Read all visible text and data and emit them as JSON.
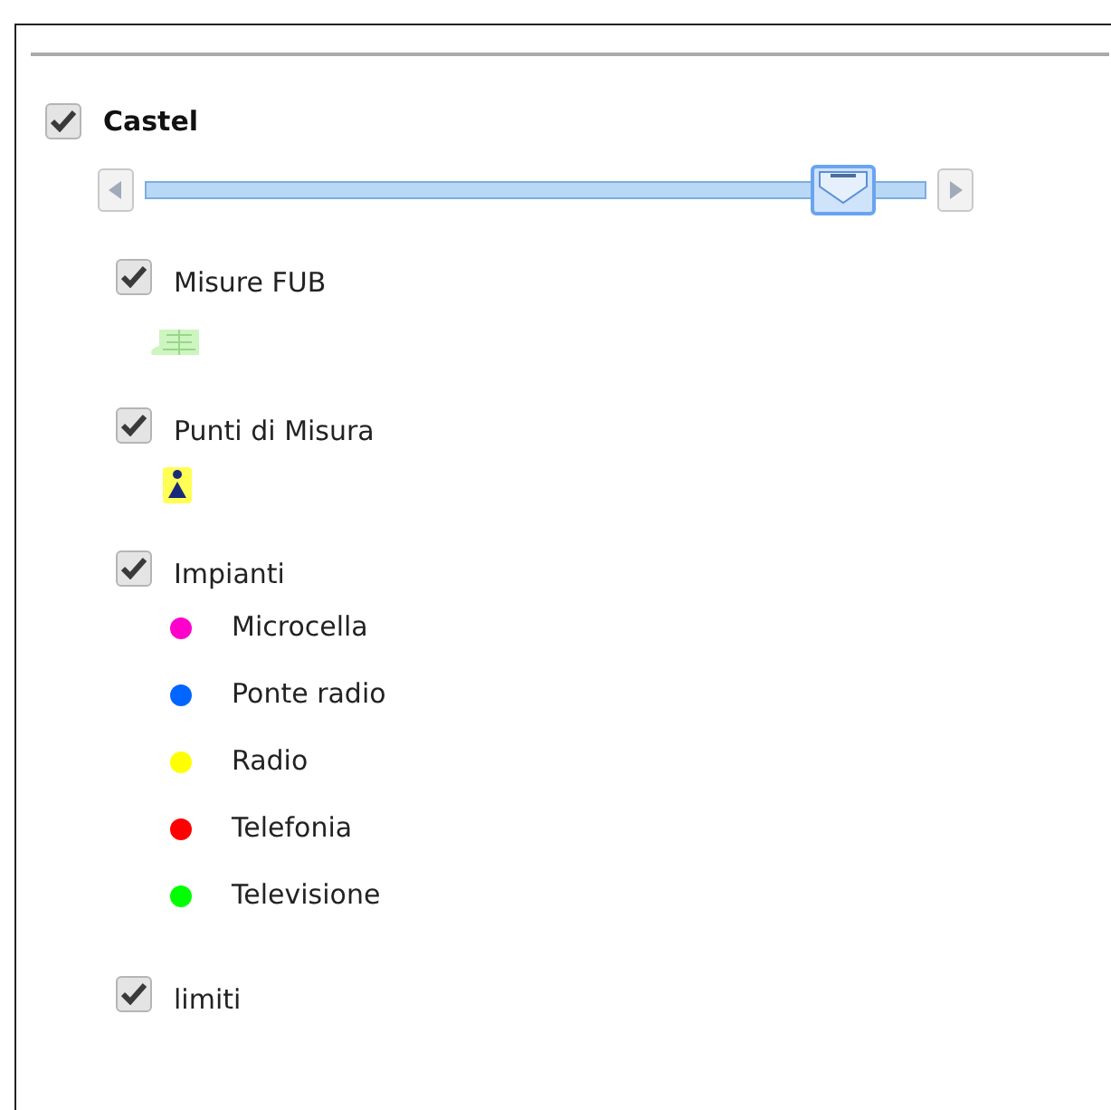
{
  "group": {
    "label": "Castel",
    "checked": true,
    "opacity": {
      "level": 0.93
    }
  },
  "layers": [
    {
      "label": "Misure FUB",
      "checked": true,
      "kind": "fub"
    },
    {
      "label": "Punti di Misura",
      "checked": true,
      "kind": "point"
    },
    {
      "label": "Impianti",
      "checked": true,
      "kind": "legend",
      "legend": [
        {
          "label": "Microcella",
          "color": "#ff00cc"
        },
        {
          "label": "Ponte radio",
          "color": "#0066ff"
        },
        {
          "label": "Radio",
          "color": "#ffff00"
        },
        {
          "label": "Telefonia",
          "color": "#ff0000"
        },
        {
          "label": "Televisione",
          "color": "#00ff00"
        }
      ]
    },
    {
      "label": "limiti",
      "checked": true,
      "kind": "plain"
    }
  ]
}
